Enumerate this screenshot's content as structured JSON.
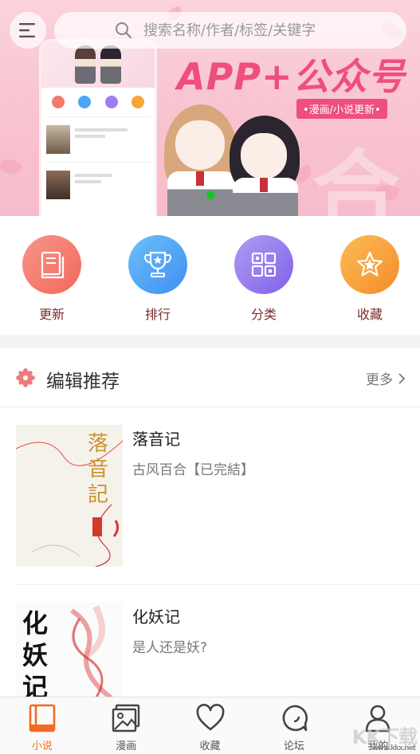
{
  "header": {
    "menu_icon": "menu-icon",
    "search_placeholder": "搜索名称/作者/标签/关键字"
  },
  "banner": {
    "headline": "APP+公众号",
    "subline": "•漫画/小说更新•",
    "background_char": "合",
    "dot_color": "#1ec02a"
  },
  "quick": {
    "items": [
      {
        "label": "更新",
        "icon": "book-icon",
        "color": "#f47a6c"
      },
      {
        "label": "排行",
        "icon": "trophy-icon",
        "color": "#4ba7f6"
      },
      {
        "label": "分类",
        "icon": "grid-icon",
        "color": "#9b7ff0"
      },
      {
        "label": "收藏",
        "icon": "star-icon",
        "color": "#f9a43b"
      }
    ]
  },
  "editor_section": {
    "title": "编辑推荐",
    "more": "更多"
  },
  "books": [
    {
      "name": "落音记",
      "desc": "古风百合【已完結】",
      "cover_text": "落音記"
    },
    {
      "name": "化妖记",
      "desc": "是人还是妖?",
      "cover_text": "化妖记"
    }
  ],
  "bottom_nav": {
    "items": [
      {
        "label": "小说",
        "icon": "novel-icon",
        "active": true
      },
      {
        "label": "漫画",
        "icon": "comic-icon",
        "active": false
      },
      {
        "label": "收藏",
        "icon": "heart-icon",
        "active": false
      },
      {
        "label": "论坛",
        "icon": "forum-icon",
        "active": false
      },
      {
        "label": "我的",
        "icon": "user-icon",
        "active": false
      }
    ],
    "active_color": "#f26b21"
  },
  "watermark": {
    "text": "KK下载",
    "url_text": "www.kkx.net"
  }
}
